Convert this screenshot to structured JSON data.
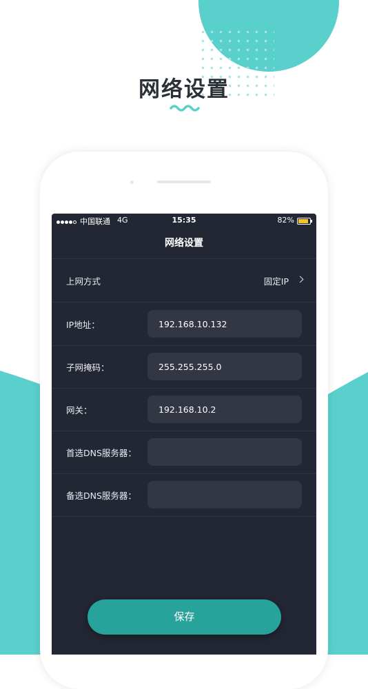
{
  "page": {
    "title": "网络设置"
  },
  "colors": {
    "accent": "#5ad0cc",
    "button": "#27a39c",
    "screen_bg": "#222733",
    "field_bg": "#323743",
    "battery": "#f5c326"
  },
  "status_bar": {
    "carrier": "中国联通",
    "network": "4G",
    "time": "15:35",
    "battery": "82%"
  },
  "nav": {
    "title": "网络设置"
  },
  "form": {
    "connection_type": {
      "label": "上网方式",
      "value": "固定IP"
    },
    "ip": {
      "label": "IP地址：",
      "value": "192.168.10.132"
    },
    "subnet": {
      "label": "子网掩码：",
      "value": "255.255.255.0"
    },
    "gateway": {
      "label": "网关：",
      "value": "192.168.10.2"
    },
    "dns_primary": {
      "label": "首选DNS服务器：",
      "value": ""
    },
    "dns_secondary": {
      "label": "备选DNS服务器：",
      "value": ""
    }
  },
  "actions": {
    "save_label": "保存"
  },
  "icons": {
    "signal": "signal-dots-icon",
    "battery": "battery-icon",
    "chevron": "chevron-right-icon"
  }
}
